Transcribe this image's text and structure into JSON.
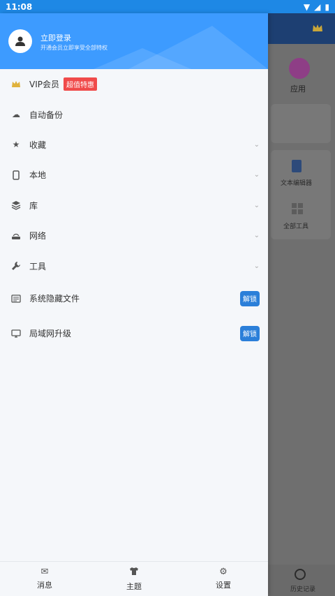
{
  "status_bar": {
    "time": "11:08"
  },
  "drawer": {
    "login_title": "立即登录",
    "login_subtitle": "开通会员立即享受全部特权",
    "menu": [
      {
        "label": "VIP会员",
        "badge": "超值特惠",
        "icon": "crown-icon"
      },
      {
        "label": "自动备份",
        "icon": "cloud-icon"
      },
      {
        "label": "收藏",
        "icon": "star-icon",
        "expandable": true
      },
      {
        "label": "本地",
        "icon": "phone-icon",
        "expandable": true
      },
      {
        "label": "库",
        "icon": "layers-icon",
        "expandable": true
      },
      {
        "label": "网络",
        "icon": "router-icon",
        "expandable": true
      },
      {
        "label": "工具",
        "icon": "wrench-icon",
        "expandable": true
      },
      {
        "label": "系统隐藏文件",
        "icon": "hidden-file-icon",
        "action": "解锁"
      },
      {
        "label": "局域网升级",
        "icon": "monitor-icon",
        "action": "解锁"
      }
    ],
    "footer": [
      {
        "label": "消息",
        "icon": "mail-icon"
      },
      {
        "label": "主题",
        "icon": "shirt-icon"
      },
      {
        "label": "设置",
        "icon": "gear-icon"
      }
    ]
  },
  "background": {
    "app_label": "应用",
    "tool1_label": "文本编辑器",
    "tool2_label": "全部工具",
    "history_label": "历史记录"
  },
  "colors": {
    "accent": "#3d9bff",
    "status_bar": "#1e88e5",
    "badge": "#f04a4a",
    "unlock": "#2b7fd9"
  }
}
